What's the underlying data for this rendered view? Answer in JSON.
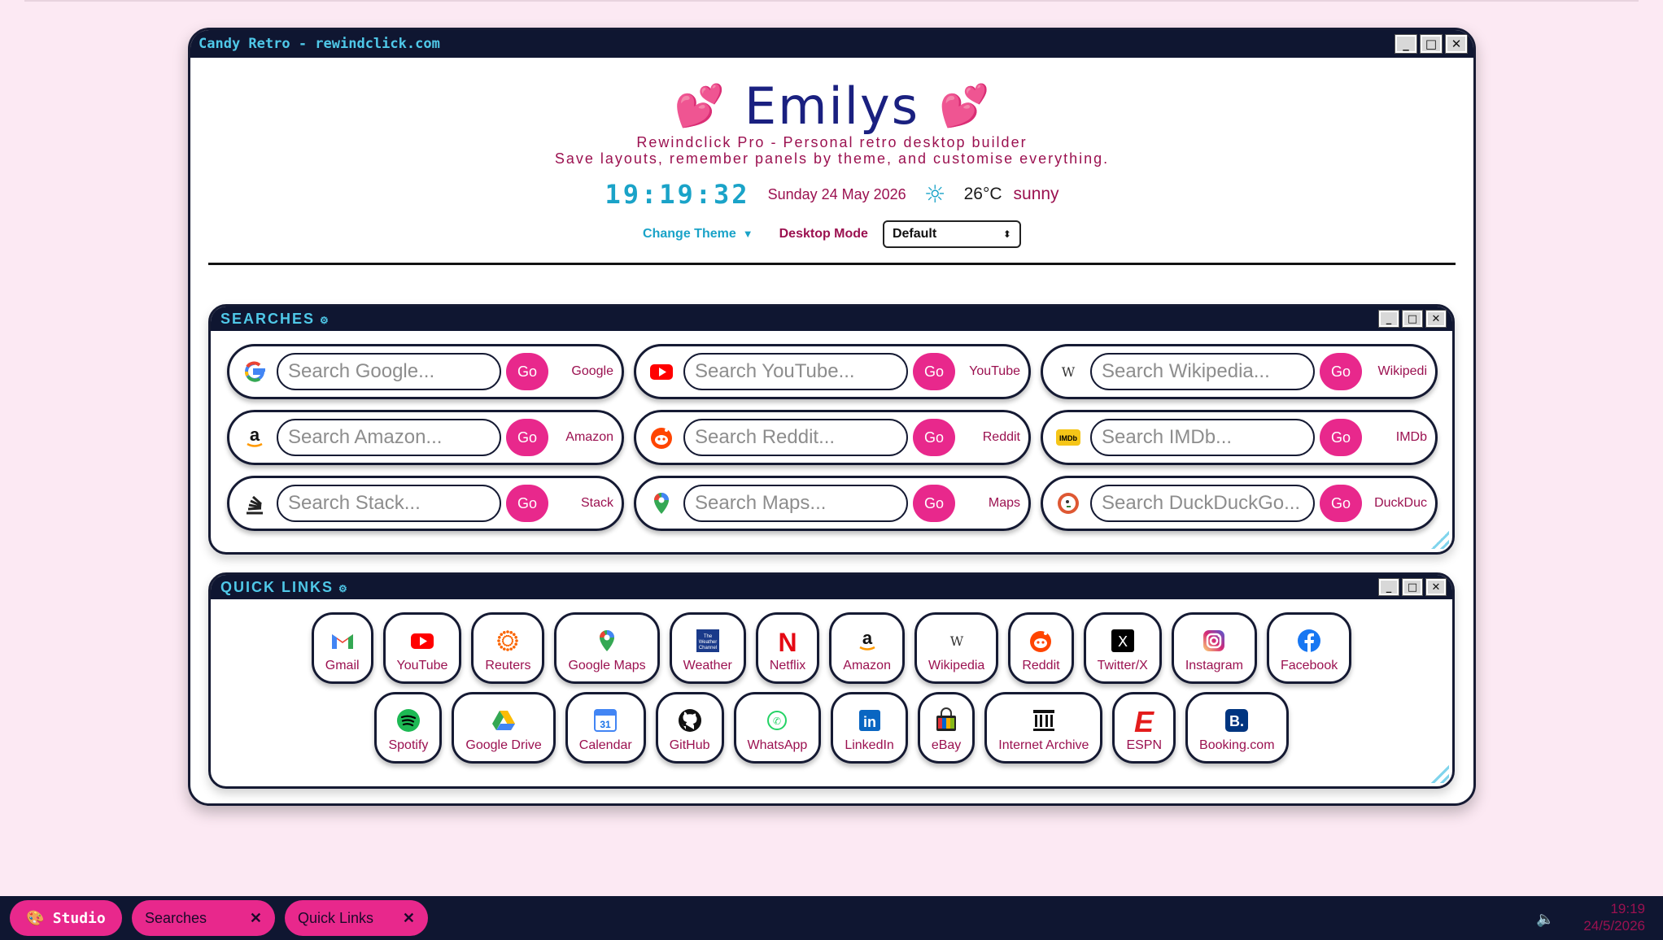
{
  "window": {
    "title": "Candy Retro - rewindclick.com"
  },
  "header": {
    "name": "Emilys",
    "heart": "💕",
    "tagline1": "Rewindclick Pro - Personal retro desktop builder",
    "tagline2": "Save layouts, remember panels by theme, and customise everything.",
    "clock": "19:19:32",
    "date": "Sunday 24 May 2026",
    "weather_icon": "☼",
    "temp": "26°C",
    "condition": "sunny",
    "theme_label": "Change Theme",
    "theme_arrow": "▼",
    "mode_label": "Desktop Mode",
    "mode_value": "Default",
    "mode_caret": "⬍"
  },
  "win_controls": {
    "minimize": "_",
    "maximize": "□",
    "close": "✕"
  },
  "searches_panel": {
    "title": "SEARCHES",
    "gear": "⚙",
    "go_label": "Go",
    "items": [
      {
        "placeholder": "Search Google...",
        "label": "Google",
        "icon": "google"
      },
      {
        "placeholder": "Search YouTube...",
        "label": "YouTube",
        "icon": "youtube"
      },
      {
        "placeholder": "Search Wikipedia...",
        "label": "Wikipedi",
        "icon": "wikipedia"
      },
      {
        "placeholder": "Search Amazon...",
        "label": "Amazon",
        "icon": "amazon"
      },
      {
        "placeholder": "Search Reddit...",
        "label": "Reddit",
        "icon": "reddit"
      },
      {
        "placeholder": "Search IMDb...",
        "label": "IMDb",
        "icon": "imdb"
      },
      {
        "placeholder": "Search Stack...",
        "label": "Stack",
        "icon": "stack"
      },
      {
        "placeholder": "Search Maps...",
        "label": "Maps",
        "icon": "maps"
      },
      {
        "placeholder": "Search DuckDuckGo...",
        "label": "DuckDuc",
        "icon": "duckduckgo"
      }
    ]
  },
  "links_panel": {
    "title": "QUICK LINKS",
    "gear": "⚙",
    "row1": [
      {
        "label": "Gmail",
        "icon": "gmail"
      },
      {
        "label": "YouTube",
        "icon": "youtube"
      },
      {
        "label": "Reuters",
        "icon": "reuters"
      },
      {
        "label": "Google Maps",
        "icon": "maps"
      },
      {
        "label": "Weather",
        "icon": "weather"
      },
      {
        "label": "Netflix",
        "icon": "netflix"
      },
      {
        "label": "Amazon",
        "icon": "amazon"
      },
      {
        "label": "Wikipedia",
        "icon": "wikipedia"
      },
      {
        "label": "Reddit",
        "icon": "reddit"
      },
      {
        "label": "Twitter/X",
        "icon": "x"
      },
      {
        "label": "Instagram",
        "icon": "instagram"
      },
      {
        "label": "Facebook",
        "icon": "facebook"
      }
    ],
    "row2": [
      {
        "label": "Spotify",
        "icon": "spotify"
      },
      {
        "label": "Google Drive",
        "icon": "drive"
      },
      {
        "label": "Calendar",
        "icon": "calendar"
      },
      {
        "label": "GitHub",
        "icon": "github"
      },
      {
        "label": "WhatsApp",
        "icon": "whatsapp"
      },
      {
        "label": "LinkedIn",
        "icon": "linkedin"
      },
      {
        "label": "eBay",
        "icon": "ebay"
      },
      {
        "label": "Internet Archive",
        "icon": "archive"
      },
      {
        "label": "ESPN",
        "icon": "espn"
      },
      {
        "label": "Booking.com",
        "icon": "booking"
      }
    ]
  },
  "taskbar": {
    "start_icon": "🎨",
    "start_label": "Studio",
    "tasks": [
      {
        "label": "Searches",
        "close": "✕"
      },
      {
        "label": "Quick Links",
        "close": "✕"
      }
    ],
    "volume": "🔈",
    "time": "19:19",
    "date": "24/5/2026"
  },
  "icon_text": {
    "amazon": "a",
    "wikipedia": "W",
    "imdb": "IMDb",
    "netflix": "N",
    "weather": "The Weather Channel",
    "calendar": "31",
    "linkedin": "in",
    "booking": "B.",
    "espn": "E",
    "x": "X",
    "whatsapp": "✆"
  }
}
